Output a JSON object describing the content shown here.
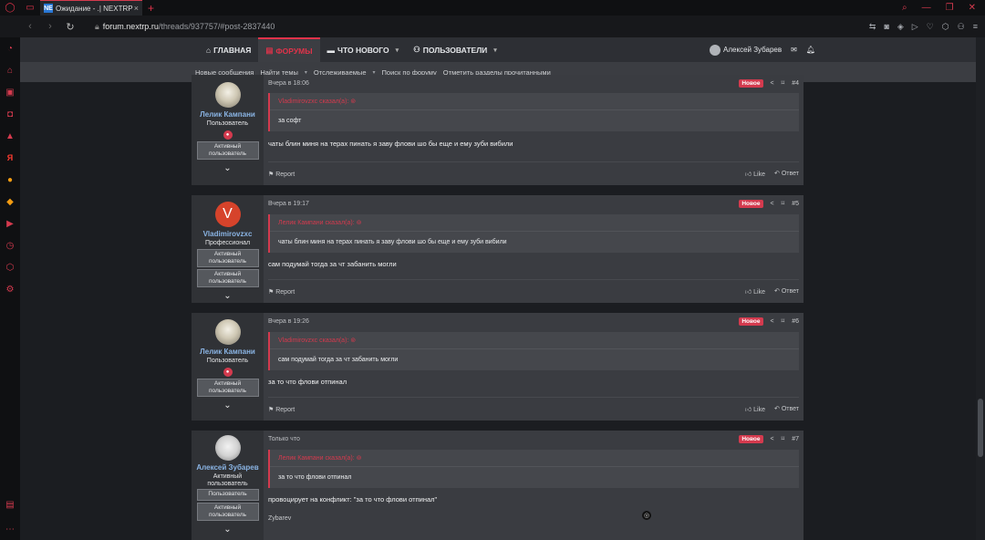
{
  "browser": {
    "tab_title": "Ожидание - .| NEXTRP",
    "tab_favicon": "NE",
    "tab_close": "×",
    "new_tab": "+",
    "url_host": "forum.nextrp.ru",
    "url_path": "/threads/937757/#post-2837440"
  },
  "nav": {
    "home": "ГЛАВНАЯ",
    "forums": "ФОРУМЫ",
    "whats_new": "ЧТО НОВОГО",
    "users": "ПОЛЬЗОВАТЕЛИ",
    "current_user": "Алексей Зубарев"
  },
  "subnav": {
    "new_messages": "Новые сообщения",
    "find_threads": "Найти темы",
    "watched": "Отслеживаемые",
    "search_forum": "Поиск по форуму",
    "mark_read": "Отметить разделы прочитанными"
  },
  "labels": {
    "new": "Новое",
    "report": "Report",
    "like": "Like",
    "reply": "Ответ"
  },
  "posts": [
    {
      "author": "Лелик Кампани",
      "title": "Пользователь",
      "banner": "Активный пользователь",
      "time": "Вчера в 18:06",
      "number": "#4",
      "quote_author": "Vladimirovzxc сказал(а):",
      "quote_text": "за софт",
      "message": "чаты блин миня на терах пинать я заву флови шо бы еще и ему зуби вибили"
    },
    {
      "author": "Vladimirovzxc",
      "avatar_letter": "V",
      "title": "Профессионал",
      "banner1": "Активный пользователь",
      "banner2": "Активный пользователь",
      "time": "Вчера в 19:17",
      "number": "#5",
      "quote_author": "Лелик Кампани сказал(а):",
      "quote_text": "чаты блин миня на терах пинать я заву флови шо бы еще и ему зуби вибили",
      "message": "сам подумай тогда за чт забанить могли"
    },
    {
      "author": "Лелик Кампани",
      "title": "Пользователь",
      "banner": "Активный пользователь",
      "time": "Вчера в 19:26",
      "number": "#6",
      "quote_author": "Vladimirovzxc сказал(а):",
      "quote_text": "сам подумай тогда за чт забанить могли",
      "message": "за то что флови отпинал"
    },
    {
      "author": "Алексей Зубарев",
      "title": "Активный пользователь",
      "banner1": "Пользователь",
      "banner2": "Активный пользователь",
      "time": "Только что",
      "number": "#7",
      "quote_author": "Лелик Кампани сказал(а):",
      "quote_text": "за то что флови отпинал",
      "message": "провоцирует на конфликт: \"за то что флови отпинал\"",
      "signature": "Zybarev"
    }
  ],
  "colors": {
    "accent": "#d43a4e",
    "link": "#8ab4e4"
  }
}
